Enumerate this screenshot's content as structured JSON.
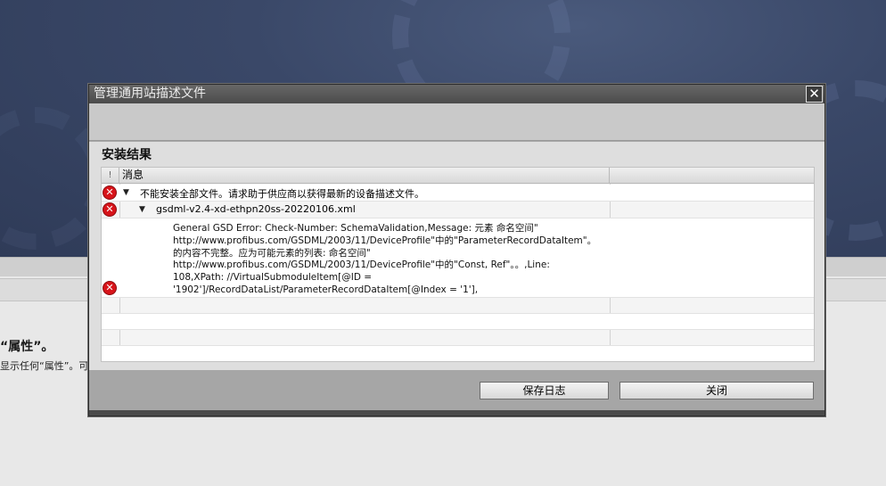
{
  "background": {
    "title_fragment": "“属性”。",
    "line_fragment": "显示任何“属性”。可能"
  },
  "dialog": {
    "title": "管理通用站描述文件",
    "close_symbol": "✕",
    "section_title": "安装结果",
    "table": {
      "headers": {
        "icon": "!",
        "message": "消息",
        "extra": ""
      },
      "rows": [
        {
          "icon": "error-icon",
          "level": 0,
          "text": "不能安装全部文件。请求助于供应商以获得最新的设备描述文件。"
        },
        {
          "icon": "error-icon",
          "level": 1,
          "text": "gsdml-v2.4-xd-ethpn20ss-20220106.xml"
        }
      ],
      "detail_lines": [
        "General GSD Error: Check-Number: SchemaValidation,Message: 元素 命名空间\"",
        "http://www.profibus.com/GSDML/2003/11/DeviceProfile\"中的\"ParameterRecordDataItem\"。",
        "的内容不完整。应为可能元素的列表: 命名空间\"",
        "http://www.profibus.com/GSDML/2003/11/DeviceProfile\"中的\"Const, Ref\"。。,Line:",
        "108,XPath: //VirtualSubmoduleItem[@ID =",
        "'1902']/RecordDataList/ParameterRecordDataItem[@Index = '1'],"
      ]
    },
    "buttons": {
      "save_log": "保存日志",
      "close": "关闭"
    }
  }
}
